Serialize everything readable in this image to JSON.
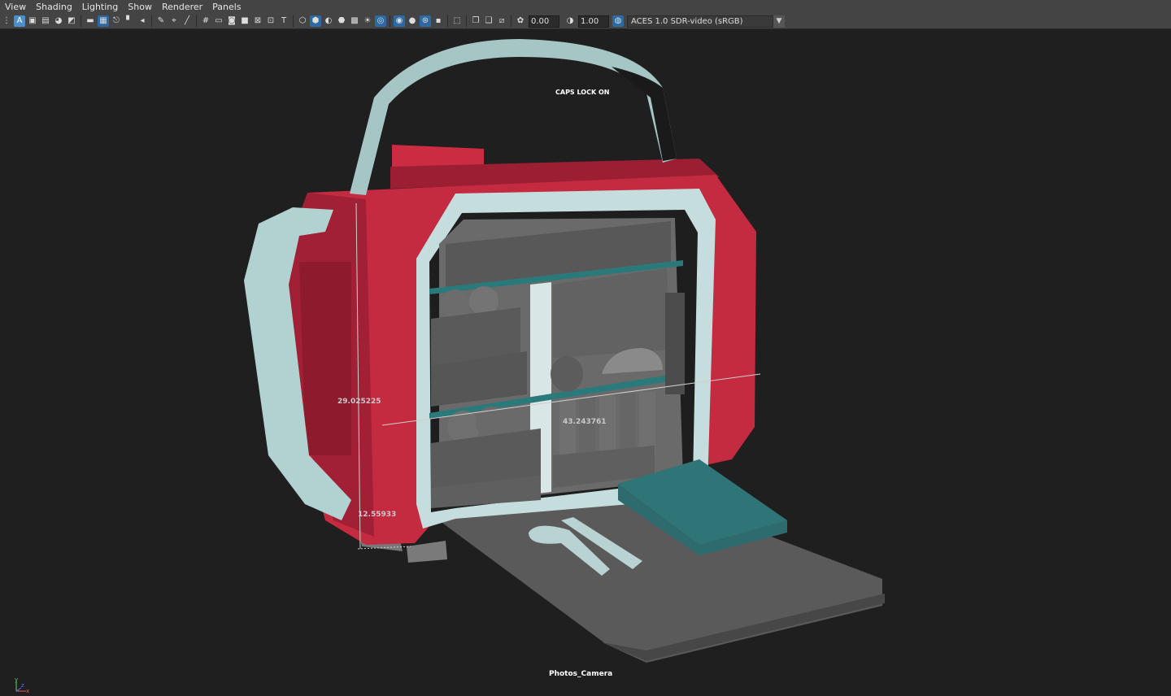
{
  "menu": [
    "View",
    "Shading",
    "Lighting",
    "Show",
    "Renderer",
    "Panels"
  ],
  "toolbar": {
    "exposure_value": "0.00",
    "gamma_value": "1.00",
    "color_space": "ACES 1.0 SDR-video (sRGB)"
  },
  "viewport": {
    "caps_lock": "CAPS LOCK ON",
    "camera_name": "Photos_Camera",
    "dimension_height": "29.025225",
    "dimension_width": "43.243761",
    "dimension_depth": "12.55933"
  },
  "axis": {
    "x": "x",
    "y": "y",
    "z": "z"
  }
}
